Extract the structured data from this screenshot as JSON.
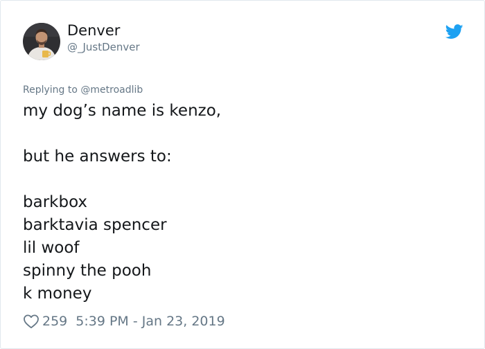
{
  "user": {
    "display_name": "Denver",
    "handle": "@_JustDenver"
  },
  "reply": {
    "prefix": "Replying to",
    "to": "@metroadlib"
  },
  "tweet": {
    "lines": [
      "my dog’s name is kenzo,",
      "",
      "but he answers to:",
      "",
      "barkbox",
      "barktavia spencer",
      "lil woof",
      "spinny the pooh",
      "k money"
    ]
  },
  "footer": {
    "likes": "259",
    "timestamp": "5:39 PM - Jan 23, 2019"
  },
  "icons": {
    "brand": "twitter-bird-icon",
    "like": "heart-icon"
  },
  "colors": {
    "brand_blue": "#1da1f2",
    "text": "#14171a",
    "secondary": "#657786",
    "border": "#e1e8ed"
  }
}
